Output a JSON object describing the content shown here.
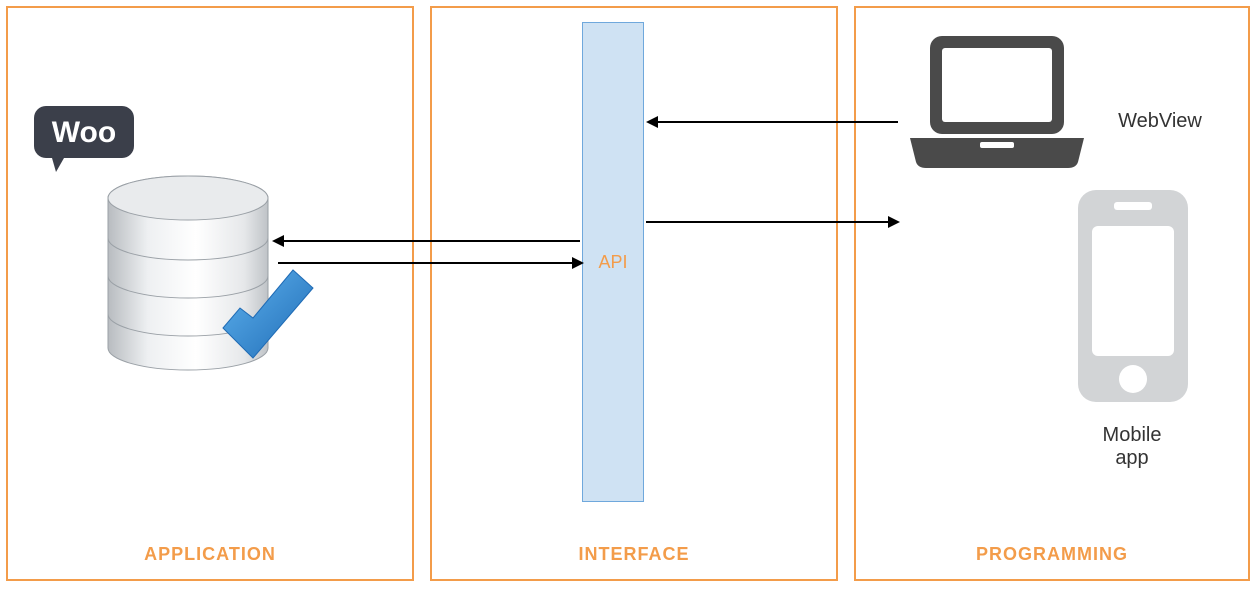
{
  "panels": {
    "application": {
      "title": "APPLICATION"
    },
    "interface": {
      "title": "INTERFACE"
    },
    "programming": {
      "title": "PROGRAMMING"
    }
  },
  "api_label": "API",
  "badges": {
    "woo": "Woo"
  },
  "clients": {
    "webview": "WebView",
    "mobile": "Mobile\napp"
  },
  "colors": {
    "accent": "#f39c4a",
    "api_fill": "#cfe2f3",
    "api_border": "#6fa8dc",
    "check": "#2f83cf",
    "woo_bg": "#3b3f4a",
    "laptop": "#4a4a4a",
    "phone": "#d2d4d6"
  }
}
